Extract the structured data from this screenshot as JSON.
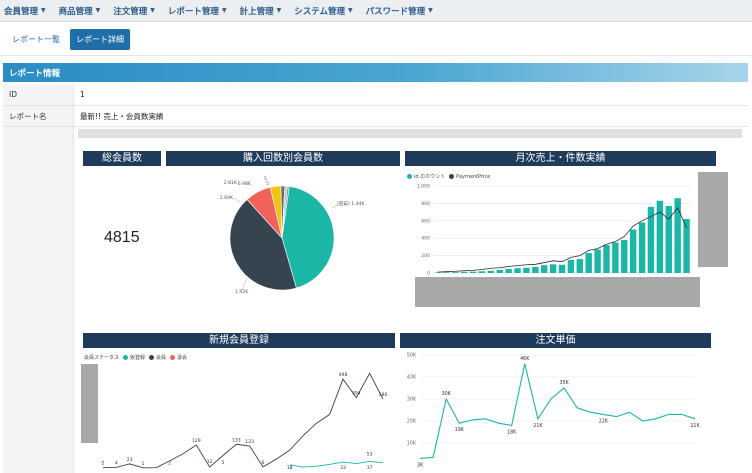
{
  "nav": [
    {
      "label": "会員管理"
    },
    {
      "label": "商品管理"
    },
    {
      "label": "注文管理"
    },
    {
      "label": "レポート管理"
    },
    {
      "label": "計上管理"
    },
    {
      "label": "システム管理"
    },
    {
      "label": "パスワード管理"
    }
  ],
  "tabs": {
    "list": "レポート一覧",
    "detail": "レポート詳細"
  },
  "section": {
    "title": "レポート情報"
  },
  "info": {
    "id_label": "ID",
    "id_value": "1",
    "name_label": "レポート名",
    "name_value": "最新!! 売上・会員数実績"
  },
  "colors": {
    "teal": "#1ab6a6",
    "dark": "#36444f",
    "navy": "#1f3b5c",
    "coral": "#f0625a",
    "yellow": "#f2c40f"
  },
  "tiles": {
    "total_members": {
      "title": "総会員数",
      "value": "4815"
    },
    "purchase_count": {
      "title": "購入回数別会員数"
    },
    "monthly": {
      "title": "月次売上・件数実績"
    },
    "new_members": {
      "title": "新規会員登録"
    },
    "order_unit": {
      "title": "注文単価"
    }
  },
  "chart_data": [
    {
      "type": "pie",
      "title": "購入回数別会員数",
      "labels": [
        "1.44K",
        "1.42K",
        "2.69K",
        "5",
        "2.81K",
        "6.98K"
      ],
      "slices": [
        {
          "value": 1440,
          "color": "#1ab6a6",
          "label": "(空白) 1.44K"
        },
        {
          "value": 1420,
          "color": "#36444f",
          "label": "1.42K"
        },
        {
          "value": 269,
          "color": "#f0625a",
          "label": "2.69K"
        },
        {
          "value": 110,
          "color": "#f2c40f",
          "label": "2.81K"
        },
        {
          "value": 40,
          "color": "#6b6b6b",
          "label": "6.98K"
        },
        {
          "value": 25,
          "color": "#b8c4cc",
          "label": "5"
        },
        {
          "value": 20,
          "color": "#8a9aa6",
          "label": ""
        }
      ]
    },
    {
      "type": "bar",
      "title": "月次売上・件数実績",
      "legend": [
        "id のカウント",
        "PaymentPrice"
      ],
      "ylim": [
        0,
        1000
      ],
      "yticks": [
        "1,000",
        "800",
        "600",
        "400",
        "200",
        "0"
      ],
      "series": [
        {
          "name": "id のカウント",
          "values": [
            5,
            8,
            10,
            12,
            15,
            20,
            25,
            35,
            45,
            55,
            60,
            70,
            90,
            100,
            95,
            150,
            160,
            230,
            270,
            320,
            350,
            380,
            500,
            580,
            760,
            830,
            770,
            860,
            620
          ]
        },
        {
          "name": "PaymentPrice",
          "values": [
            10,
            15,
            20,
            25,
            30,
            40,
            55,
            60,
            75,
            85,
            95,
            100,
            120,
            140,
            130,
            180,
            200,
            260,
            280,
            330,
            360,
            420,
            540,
            600,
            650,
            700,
            620,
            750,
            520
          ]
        }
      ]
    },
    {
      "type": "line",
      "title": "新規会員登録",
      "legend": [
        {
          "label": "会員ステータス",
          "color": ""
        },
        {
          "label": "仮登録",
          "color": "#1ab6a6"
        },
        {
          "label": "会員",
          "color": "#36444f"
        },
        {
          "label": "退会",
          "color": "#f0625a"
        }
      ],
      "series": [
        {
          "name": "会員",
          "values": [
            2,
            4,
            23,
            1,
            2,
            40,
            80,
            129,
            5,
            70,
            133,
            123,
            6,
            50,
            100,
            180,
            250,
            300,
            498,
            394,
            530,
            386
          ]
        },
        {
          "name": "仮登録",
          "values": [
            null,
            null,
            null,
            null,
            null,
            null,
            null,
            null,
            null,
            null,
            null,
            null,
            null,
            null,
            18,
            5,
            10,
            20,
            33,
            25,
            37,
            30
          ]
        }
      ],
      "labels": [
        "2",
        "4",
        "23",
        "1",
        "2",
        "129",
        "12",
        "5",
        "133",
        "123",
        "6",
        "498",
        "394",
        "53",
        "386",
        "18",
        "33",
        "37"
      ]
    },
    {
      "type": "line",
      "title": "注文単価",
      "ylim": [
        0,
        50000
      ],
      "yticks": [
        "50K",
        "40K",
        "30K",
        "20K",
        "10K"
      ],
      "series": [
        {
          "name": "注文単価",
          "values": [
            3000,
            3500,
            30000,
            19000,
            20500,
            21000,
            19000,
            18000,
            46000,
            21000,
            30000,
            35000,
            26000,
            24000,
            23000,
            22000,
            24000,
            20000,
            21000,
            23000,
            23000,
            21000
          ]
        }
      ],
      "labels": [
        "3K",
        "30K",
        "19K",
        "18K",
        "46K",
        "21K",
        "35K",
        "22K",
        "21K"
      ]
    }
  ]
}
